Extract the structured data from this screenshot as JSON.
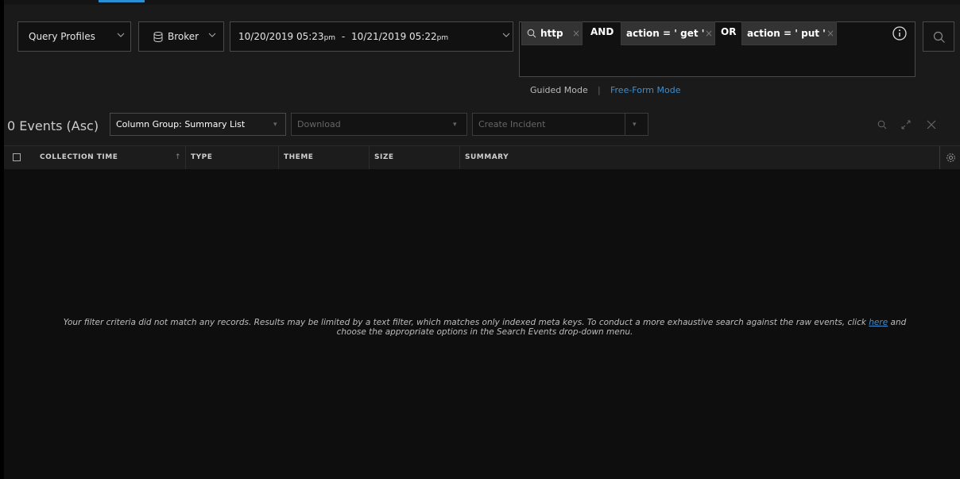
{
  "query_bar": {
    "query_profiles_label": "Query Profiles",
    "service_label": "Broker",
    "time_range": {
      "start_date": "10/20/2019 05:23",
      "start_ampm": "pm",
      "separator": "-",
      "end_date": "10/21/2019 05:22",
      "end_ampm": "pm"
    },
    "filter_pills": [
      {
        "text": "http"
      },
      {
        "text": "action = ' get '"
      },
      {
        "text": "action = ' put '"
      }
    ],
    "operators": [
      "AND",
      "OR"
    ],
    "modes": {
      "guided": "Guided Mode",
      "separator": "|",
      "free_form": "Free-Form Mode",
      "active": "free_form"
    }
  },
  "results": {
    "events_count": "0 Events (Asc)",
    "column_group": "Column Group: Summary List",
    "download_placeholder": "Download",
    "create_incident_placeholder": "Create Incident"
  },
  "table": {
    "columns": [
      "COLLECTION TIME",
      "TYPE",
      "THEME",
      "SIZE",
      "SUMMARY"
    ],
    "rows": [],
    "sort_indicator": "↑"
  },
  "empty_state": {
    "line1_prefix": "Your filter criteria did not match any records. Results may be limited by a text filter, which matches only indexed meta keys. To conduct a more exhaustive search against the raw events, click ",
    "link_text": "here",
    "line1_suffix": " and",
    "line2": "choose the appropriate options in the Search Events drop-down menu."
  },
  "colors": {
    "accent": "#2b8fd6",
    "link": "#3b8fd0",
    "background": "#0d0d0d",
    "panel": "#1a1a1a"
  },
  "icons": [
    "database-icon",
    "search-icon",
    "info-icon",
    "search-submit-icon",
    "close-icon",
    "expand-icon",
    "gear-icon",
    "chevron-down-icon"
  ]
}
